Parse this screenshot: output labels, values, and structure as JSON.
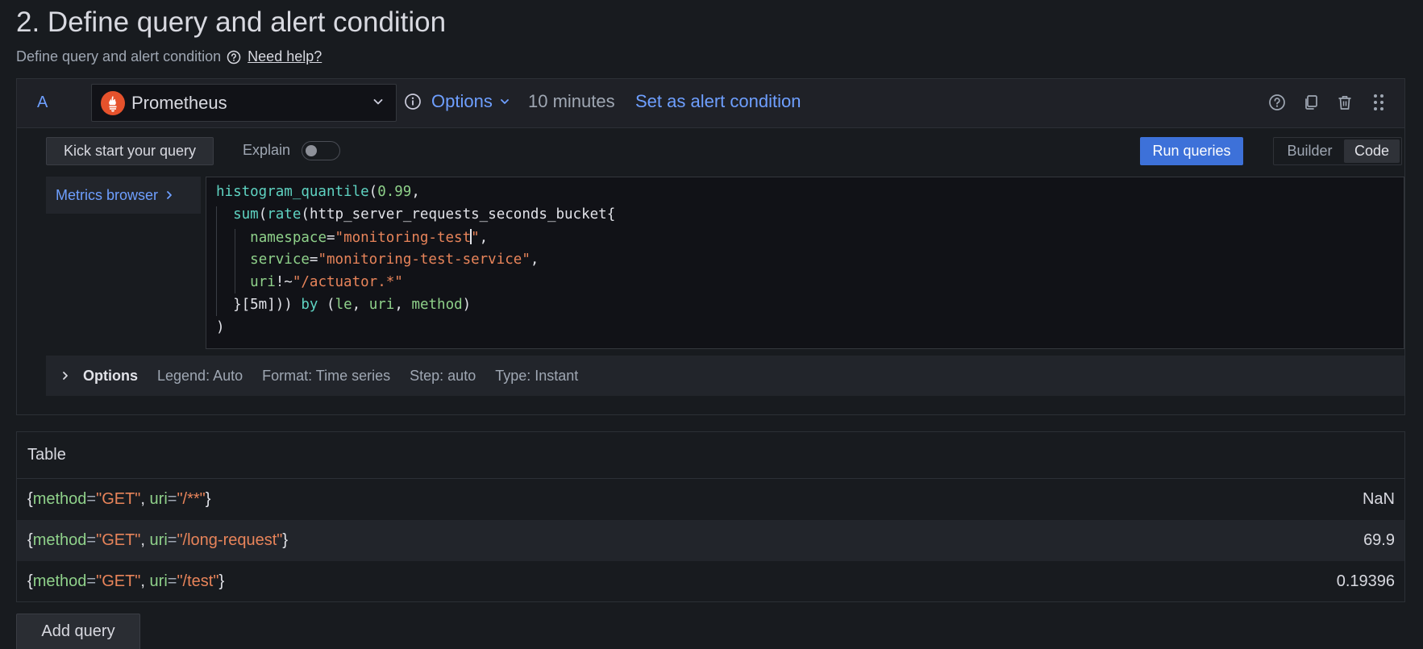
{
  "section": {
    "title": "2. Define query and alert condition",
    "subtitle": "Define query and alert condition",
    "help_link": "Need help?"
  },
  "query": {
    "letter": "A",
    "datasource": "Prometheus",
    "options_label": "Options",
    "time_range": "10 minutes",
    "alert_condition_label": "Set as alert condition",
    "kick_start_label": "Kick start your query",
    "explain_label": "Explain",
    "explain_enabled": false,
    "run_label": "Run queries",
    "modes": [
      "Builder",
      "Code"
    ],
    "active_mode": "Code",
    "metrics_browser_label": "Metrics browser",
    "code": {
      "l1_fn": "histogram_quantile",
      "l1_open": "(",
      "l1_num": "0.99",
      "l1_comma": ",",
      "l2_fn1": "sum",
      "l2_p1": "(",
      "l2_fn2": "rate",
      "l2_p2": "(",
      "l2_metric": "http_server_requests_seconds_bucket{",
      "l3_label": "namespace",
      "l3_eq": "=",
      "l3_str_a": "\"monitoring-test",
      "l3_str_b": "\"",
      "l3_comma": ",",
      "l4_label": "service",
      "l4_eq": "=",
      "l4_str": "\"monitoring-test-service\"",
      "l4_comma": ",",
      "l5_label": "uri",
      "l5_op": "!~",
      "l5_str": "\"/actuator.*\"",
      "l6_close": "}[5m]))",
      "l6_by": "by",
      "l6_open": "(",
      "l6_g1": "le",
      "l6_c1": ",",
      "l6_g2": "uri",
      "l6_c2": ",",
      "l6_g3": "method",
      "l6_close2": ")",
      "l7_close": ")"
    },
    "options_row": {
      "title": "Options",
      "legend": "Legend: Auto",
      "format": "Format: Time series",
      "step": "Step: auto",
      "type": "Type: Instant"
    }
  },
  "table": {
    "title": "Table",
    "rows": [
      {
        "method": "\"GET\"",
        "uri": "\"/**\"",
        "value": "NaN"
      },
      {
        "method": "\"GET\"",
        "uri": "\"/long-request\"",
        "value": "69.9"
      },
      {
        "method": "\"GET\"",
        "uri": "\"/test\"",
        "value": "0.19396"
      }
    ],
    "tokens": {
      "open": "{",
      "method_key": "method",
      "uri_key": "uri",
      "eq": "=",
      "sep": ", ",
      "close": "}"
    }
  },
  "add_query_label": "Add query",
  "icons": {
    "help": "question-circle-icon",
    "info": "info-circle-icon",
    "datasource": "prometheus-logo-icon",
    "dropdown": "chevron-down-icon",
    "duplicate": "copy-icon",
    "delete": "trash-icon",
    "drag": "drag-handle-icon",
    "expand": "chevron-right-icon"
  },
  "colors": {
    "background": "#181b1f",
    "accent": "#6e9fff",
    "primary_button": "#3d71d9",
    "prometheus": "#e6522c",
    "code_function": "#5fd3c2",
    "code_label": "#8fd18a",
    "code_string": "#e8845a"
  }
}
